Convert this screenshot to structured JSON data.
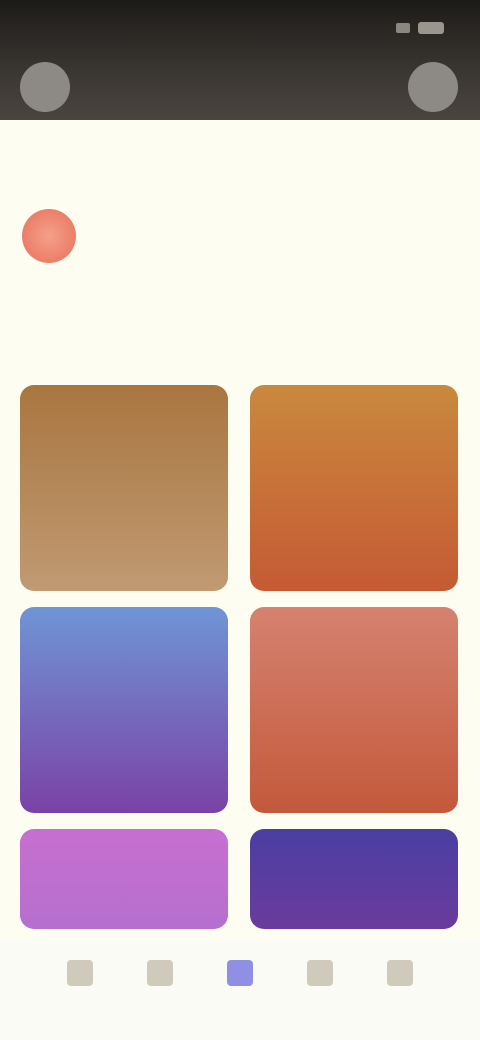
{
  "status": {
    "time": ""
  },
  "topbar": {
    "title": ""
  },
  "recent": {
    "heading": "",
    "item_title": "",
    "item_subtitle": ""
  },
  "browse": {
    "heading": "",
    "tiles": [
      {
        "label": "",
        "gradient": [
          "#a9763f",
          "#c09a73"
        ]
      },
      {
        "label": "",
        "gradient": [
          "#c9893d",
          "#c65a34"
        ]
      },
      {
        "label": "",
        "gradient": [
          "#6f95d6",
          "#7a42a6"
        ]
      },
      {
        "label": "",
        "gradient": [
          "#d58270",
          "#c4593b"
        ]
      },
      {
        "label": "",
        "gradient": [
          "#c76fd0",
          "#b56fce"
        ]
      },
      {
        "label": "",
        "gradient": [
          "#4a3fa3",
          "#6a3b9c"
        ]
      }
    ]
  },
  "nav": {
    "items": [
      {
        "name": "nav-home",
        "label": ""
      },
      {
        "name": "nav-search",
        "label": ""
      },
      {
        "name": "nav-browse",
        "label": ""
      },
      {
        "name": "nav-library",
        "label": ""
      },
      {
        "name": "nav-more",
        "label": ""
      }
    ]
  },
  "colors": {
    "background": "#fdfdf1",
    "topbar": "#2e2b28",
    "accent": "#8f8fe3"
  }
}
